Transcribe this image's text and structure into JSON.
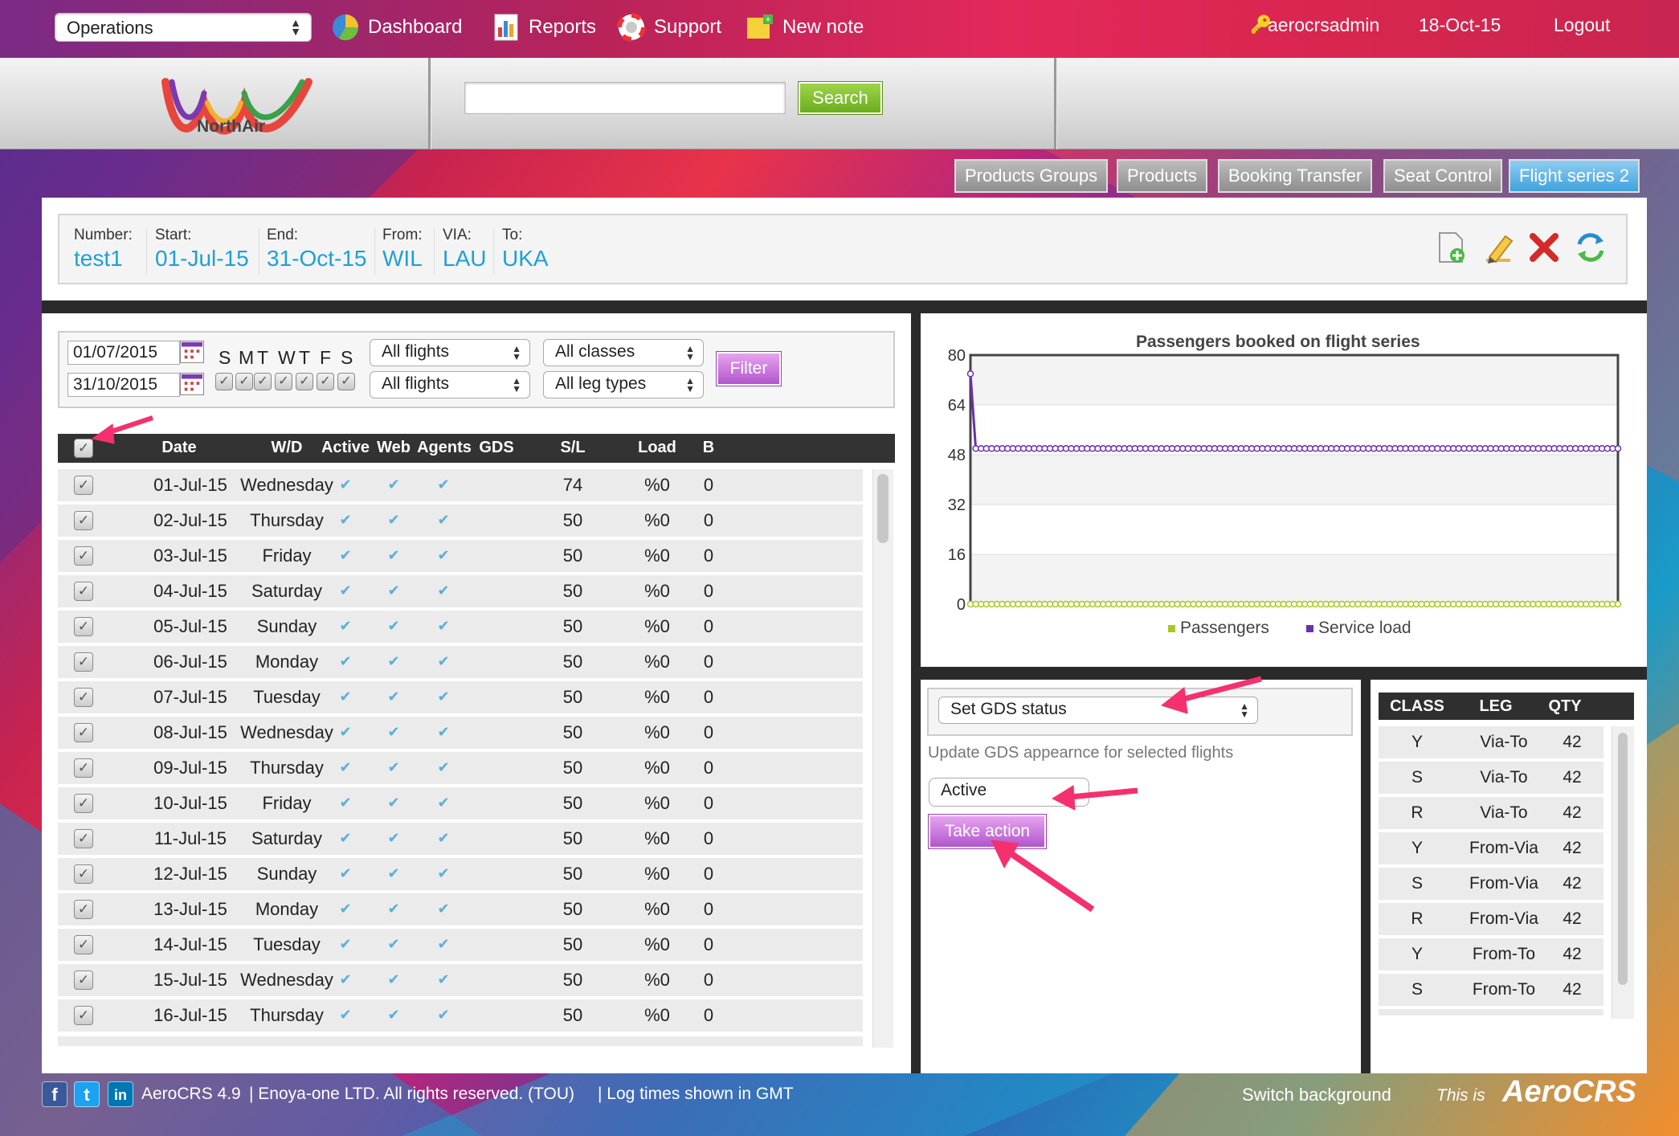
{
  "topbar": {
    "department": "Operations",
    "nav": [
      {
        "label": "Dashboard",
        "icon": "dashboard-pie-icon"
      },
      {
        "label": "Reports",
        "icon": "reports-chart-icon"
      },
      {
        "label": "Support",
        "icon": "support-lifebuoy-icon"
      },
      {
        "label": "New note",
        "icon": "new-note-icon"
      }
    ],
    "username": "aerocrsadmin",
    "date": "18-Oct-15",
    "logout": "Logout"
  },
  "header": {
    "logo_text": "NorthAir",
    "search_value": "",
    "search_label": "Search"
  },
  "tabs": [
    "Products Groups",
    "Products",
    "Booking Transfer",
    "Seat Control",
    "Flight series 2"
  ],
  "active_tab": "Flight series 2",
  "series_info": {
    "number": {
      "label": "Number:",
      "value": "test1"
    },
    "start": {
      "label": "Start:",
      "value": "01-Jul-15"
    },
    "end": {
      "label": "End:",
      "value": "31-Oct-15"
    },
    "from": {
      "label": "From:",
      "value": "WIL"
    },
    "via": {
      "label": "VIA:",
      "value": "LAU"
    },
    "to": {
      "label": "To:",
      "value": "UKA"
    }
  },
  "toolbar_icons": [
    "add-document-icon",
    "edit-pencil-icon",
    "delete-x-icon",
    "sync-arrows-icon"
  ],
  "filter": {
    "date_from": "01/07/2015",
    "date_to": "31/10/2015",
    "days": [
      "S",
      "M",
      "T",
      "W",
      "T",
      "F",
      "S"
    ],
    "flights_select_1": "All flights",
    "flights_select_2": "All flights",
    "classes_select": "All classes",
    "legtypes_select": "All leg types",
    "filter_label": "Filter"
  },
  "flights_table": {
    "columns": [
      "Date",
      "W/D",
      "Active",
      "Web",
      "Agents",
      "GDS",
      "S/L",
      "Load",
      "B"
    ],
    "rows": [
      {
        "date": "01-Jul-15",
        "wd": "Wednesday",
        "sl": "74",
        "load": "%0",
        "b": "0"
      },
      {
        "date": "02-Jul-15",
        "wd": "Thursday",
        "sl": "50",
        "load": "%0",
        "b": "0"
      },
      {
        "date": "03-Jul-15",
        "wd": "Friday",
        "sl": "50",
        "load": "%0",
        "b": "0"
      },
      {
        "date": "04-Jul-15",
        "wd": "Saturday",
        "sl": "50",
        "load": "%0",
        "b": "0"
      },
      {
        "date": "05-Jul-15",
        "wd": "Sunday",
        "sl": "50",
        "load": "%0",
        "b": "0"
      },
      {
        "date": "06-Jul-15",
        "wd": "Monday",
        "sl": "50",
        "load": "%0",
        "b": "0"
      },
      {
        "date": "07-Jul-15",
        "wd": "Tuesday",
        "sl": "50",
        "load": "%0",
        "b": "0"
      },
      {
        "date": "08-Jul-15",
        "wd": "Wednesday",
        "sl": "50",
        "load": "%0",
        "b": "0"
      },
      {
        "date": "09-Jul-15",
        "wd": "Thursday",
        "sl": "50",
        "load": "%0",
        "b": "0"
      },
      {
        "date": "10-Jul-15",
        "wd": "Friday",
        "sl": "50",
        "load": "%0",
        "b": "0"
      },
      {
        "date": "11-Jul-15",
        "wd": "Saturday",
        "sl": "50",
        "load": "%0",
        "b": "0"
      },
      {
        "date": "12-Jul-15",
        "wd": "Sunday",
        "sl": "50",
        "load": "%0",
        "b": "0"
      },
      {
        "date": "13-Jul-15",
        "wd": "Monday",
        "sl": "50",
        "load": "%0",
        "b": "0"
      },
      {
        "date": "14-Jul-15",
        "wd": "Tuesday",
        "sl": "50",
        "load": "%0",
        "b": "0"
      },
      {
        "date": "15-Jul-15",
        "wd": "Wednesday",
        "sl": "50",
        "load": "%0",
        "b": "0"
      },
      {
        "date": "16-Jul-15",
        "wd": "Thursday",
        "sl": "50",
        "load": "%0",
        "b": "0"
      }
    ]
  },
  "chart_data": {
    "type": "line",
    "title": "Passengers booked on flight series",
    "ylim": [
      0,
      80
    ],
    "yticks": [
      0,
      16,
      32,
      48,
      64,
      80
    ],
    "series": [
      {
        "name": "Passengers",
        "color": "#a8c820",
        "value_first": 0,
        "value_rest": 0
      },
      {
        "name": "Service load",
        "color": "#6a2fb0",
        "value_first": 74,
        "value_rest": 50
      }
    ],
    "point_count": 123,
    "grid": true,
    "legend": "bottom"
  },
  "actions": {
    "action_select": "Set GDS status",
    "note": "Update GDS appearnce for selected flights",
    "status_select": "Active",
    "take_action_label": "Take action"
  },
  "class_table": {
    "columns": [
      "CLASS",
      "LEG",
      "QTY"
    ],
    "rows": [
      {
        "cls": "Y",
        "leg": "Via-To",
        "qty": "42"
      },
      {
        "cls": "S",
        "leg": "Via-To",
        "qty": "42"
      },
      {
        "cls": "R",
        "leg": "Via-To",
        "qty": "42"
      },
      {
        "cls": "Y",
        "leg": "From-Via",
        "qty": "42"
      },
      {
        "cls": "S",
        "leg": "From-Via",
        "qty": "42"
      },
      {
        "cls": "R",
        "leg": "From-Via",
        "qty": "42"
      },
      {
        "cls": "Y",
        "leg": "From-To",
        "qty": "42"
      },
      {
        "cls": "S",
        "leg": "From-To",
        "qty": "42"
      }
    ]
  },
  "footer": {
    "version": "AeroCRS 4.9",
    "rights": "| Enoya-one LTD. All rights reserved. (TOU)",
    "log_note": "| Log times shown in GMT",
    "switch_bg": "Switch background",
    "this_is": "This is",
    "brand": "AeroCRS",
    "social": [
      {
        "letter": "f",
        "icon": "facebook-icon"
      },
      {
        "letter": "t",
        "icon": "twitter-icon"
      },
      {
        "letter": "in",
        "icon": "linkedin-icon"
      }
    ]
  }
}
